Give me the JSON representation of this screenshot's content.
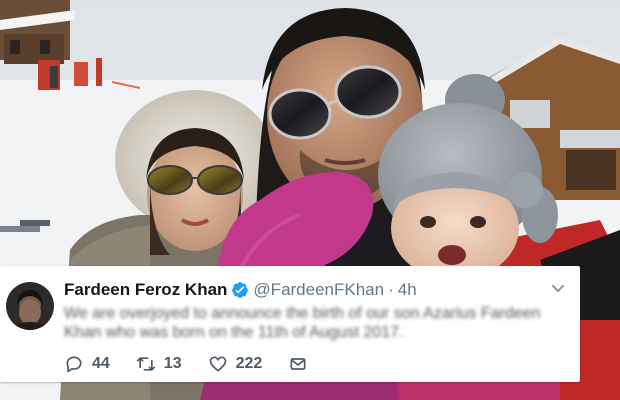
{
  "photo": {
    "description_icons": [
      "ski-resort-scene"
    ]
  },
  "tweet": {
    "display_name": "Fardeen Feroz Khan",
    "handle": "@FardeenFKhan",
    "separator": "·",
    "time": "4h",
    "text": "We are overjoyed to announce the birth of our son Azarius Fardeen Khan who was born on the 11th of August 2017.",
    "replies": "44",
    "retweets": "13",
    "likes": "222",
    "colors": {
      "verified": "#1da1f2",
      "name": "#14171a",
      "meta": "#657786"
    },
    "icons": [
      "reply-icon",
      "retweet-icon",
      "like-icon",
      "message-icon",
      "verified-badge-icon",
      "chevron-down-icon"
    ]
  }
}
